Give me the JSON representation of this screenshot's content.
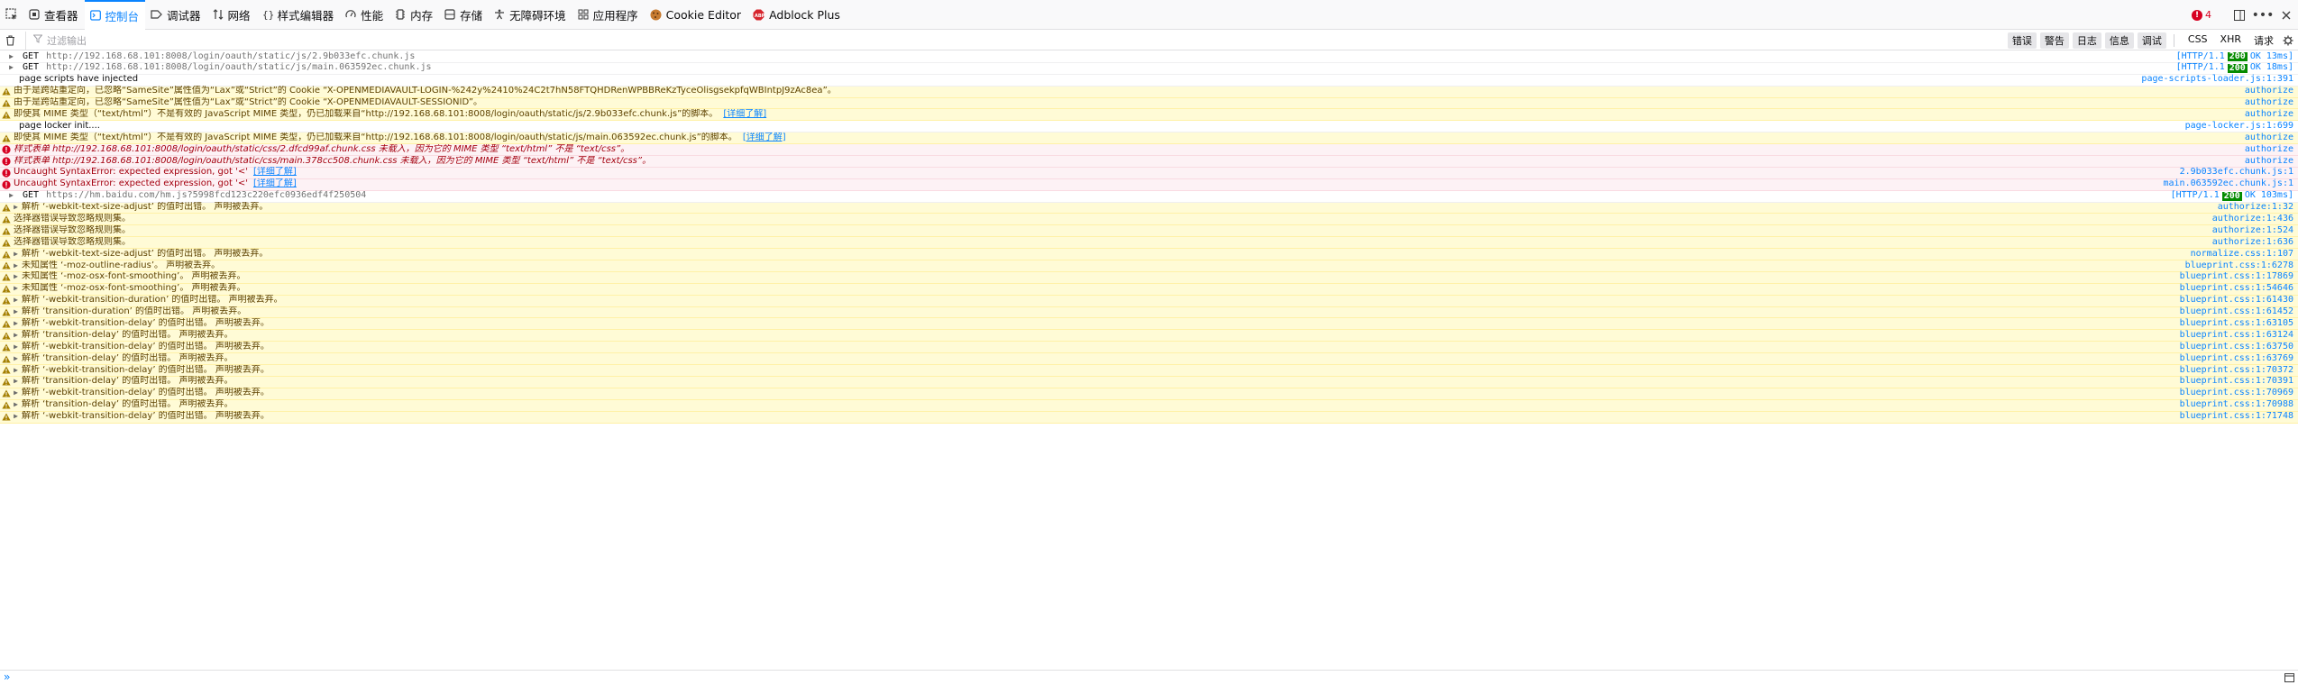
{
  "toolbar": {
    "tabs": [
      {
        "label": "查看器",
        "icon": "inspector-icon"
      },
      {
        "label": "控制台",
        "icon": "console-icon",
        "selected": true
      },
      {
        "label": "调试器",
        "icon": "debugger-icon"
      },
      {
        "label": "网络",
        "icon": "network-icon"
      },
      {
        "label": "样式编辑器",
        "icon": "style-editor-icon"
      },
      {
        "label": "性能",
        "icon": "performance-icon"
      },
      {
        "label": "内存",
        "icon": "memory-icon"
      },
      {
        "label": "存储",
        "icon": "storage-icon"
      },
      {
        "label": "无障碍环境",
        "icon": "accessibility-icon"
      },
      {
        "label": "应用程序",
        "icon": "application-icon"
      },
      {
        "label": "Cookie Editor",
        "icon": "cookie-icon"
      },
      {
        "label": "Adblock Plus",
        "icon": "adblock-icon"
      }
    ],
    "error_count": "4",
    "accent": "#0a84ff"
  },
  "filter": {
    "placeholder": "过滤输出",
    "levels": [
      "错误",
      "警告",
      "日志",
      "信息",
      "调试"
    ],
    "types": [
      "CSS",
      "XHR",
      "请求"
    ]
  },
  "messages": [
    {
      "type": "net",
      "method": "GET",
      "url": "http://192.168.68.101:8008/login/oauth/static/js/2.9b033efc.chunk.js",
      "proto": "[HTTP/1.1",
      "code": "200",
      "text": "OK 13ms]"
    },
    {
      "type": "net",
      "method": "GET",
      "url": "http://192.168.68.101:8008/login/oauth/static/js/main.063592ec.chunk.js",
      "proto": "[HTTP/1.1",
      "code": "200",
      "text": "OK 18ms]"
    },
    {
      "type": "log",
      "text": "page scripts have injected",
      "src": "page-scripts-loader.js:1:391"
    },
    {
      "type": "warn",
      "text": "由于是跨站重定向，已忽略“SameSite”属性值为“Lax”或“Strict”的 Cookie “X-OPENMEDIAVAULT-LOGIN-%242y%2410%24C2t7hN58FTQHDRenWPBBReKzTyceOlisgsekpfqWBIntpJ9zAc8ea”。",
      "src": "authorize"
    },
    {
      "type": "warn",
      "text": "由于是跨站重定向，已忽略“SameSite”属性值为“Lax”或“Strict”的 Cookie “X-OPENMEDIAVAULT-SESSIONID”。",
      "src": "authorize"
    },
    {
      "type": "warn",
      "text": "即使其 MIME 类型（“text/html”）不是有效的 JavaScript MIME 类型，仍已加载来自“http://192.168.68.101:8008/login/oauth/static/js/2.9b033efc.chunk.js”的脚本。",
      "link": "[详细了解]",
      "src": "authorize"
    },
    {
      "type": "log",
      "text": "page locker init....",
      "src": "page-locker.js:1:699"
    },
    {
      "type": "warn",
      "text": "即使其 MIME 类型（“text/html”）不是有效的 JavaScript MIME 类型，仍已加载来自“http://192.168.68.101:8008/login/oauth/static/js/main.063592ec.chunk.js”的脚本。",
      "link": "[详细了解]",
      "src": "authorize"
    },
    {
      "type": "error",
      "text": "样式表单 http://192.168.68.101:8008/login/oauth/static/css/2.dfcd99af.chunk.css 未载入，因为它的 MIME 类型 “text/html” 不是 “text/css”。",
      "src": "authorize"
    },
    {
      "type": "error",
      "text": "样式表单 http://192.168.68.101:8008/login/oauth/static/css/main.378cc508.chunk.css 未载入，因为它的 MIME 类型 “text/html” 不是 “text/css”。",
      "src": "authorize"
    },
    {
      "type": "error",
      "text": "Uncaught SyntaxError: expected expression, got '<'",
      "link": "[详细了解]",
      "src": "2.9b033efc.chunk.js:1"
    },
    {
      "type": "error",
      "text": "Uncaught SyntaxError: expected expression, got '<'",
      "link": "[详细了解]",
      "src": "main.063592ec.chunk.js:1"
    },
    {
      "type": "net",
      "method": "GET",
      "url": "https://hm.baidu.com/hm.js?5998fcd123c220efc0936edf4f250504",
      "proto": "[HTTP/1.1",
      "code": "200",
      "text": "OK 103ms]"
    },
    {
      "type": "warn",
      "tw": true,
      "text": "解析 ‘-webkit-text-size-adjust’ 的值时出错。  声明被丢弃。",
      "src": "authorize:1:32"
    },
    {
      "type": "warn",
      "text": "选择器错误导致忽略规则集。",
      "src": "authorize:1:436"
    },
    {
      "type": "warn",
      "text": "选择器错误导致忽略规则集。",
      "src": "authorize:1:524"
    },
    {
      "type": "warn",
      "text": "选择器错误导致忽略规则集。",
      "src": "authorize:1:636"
    },
    {
      "type": "warn",
      "tw": true,
      "text": "解析 ‘-webkit-text-size-adjust’ 的值时出错。  声明被丢弃。",
      "src": "normalize.css:1:107"
    },
    {
      "type": "warn",
      "tw": true,
      "text": "未知属性 ‘-moz-outline-radius’。  声明被丢弃。",
      "src": "blueprint.css:1:6278"
    },
    {
      "type": "warn",
      "tw": true,
      "text": "未知属性 ‘-moz-osx-font-smoothing’。  声明被丢弃。",
      "src": "blueprint.css:1:17869"
    },
    {
      "type": "warn",
      "tw": true,
      "text": "未知属性 ‘-moz-osx-font-smoothing’。  声明被丢弃。",
      "src": "blueprint.css:1:54646"
    },
    {
      "type": "warn",
      "tw": true,
      "text": "解析 ‘-webkit-transition-duration’ 的值时出错。  声明被丢弃。",
      "src": "blueprint.css:1:61430"
    },
    {
      "type": "warn",
      "tw": true,
      "text": "解析 ‘transition-duration’ 的值时出错。  声明被丢弃。",
      "src": "blueprint.css:1:61452"
    },
    {
      "type": "warn",
      "tw": true,
      "text": "解析 ‘-webkit-transition-delay’ 的值时出错。  声明被丢弃。",
      "src": "blueprint.css:1:63105"
    },
    {
      "type": "warn",
      "tw": true,
      "text": "解析 ‘transition-delay’ 的值时出错。  声明被丢弃。",
      "src": "blueprint.css:1:63124"
    },
    {
      "type": "warn",
      "tw": true,
      "text": "解析 ‘-webkit-transition-delay’ 的值时出错。  声明被丢弃。",
      "src": "blueprint.css:1:63750"
    },
    {
      "type": "warn",
      "tw": true,
      "text": "解析 ‘transition-delay’ 的值时出错。  声明被丢弃。",
      "src": "blueprint.css:1:63769"
    },
    {
      "type": "warn",
      "tw": true,
      "text": "解析 ‘-webkit-transition-delay’ 的值时出错。  声明被丢弃。",
      "src": "blueprint.css:1:70372"
    },
    {
      "type": "warn",
      "tw": true,
      "text": "解析 ‘transition-delay’ 的值时出错。  声明被丢弃。",
      "src": "blueprint.css:1:70391"
    },
    {
      "type": "warn",
      "tw": true,
      "text": "解析 ‘-webkit-transition-delay’ 的值时出错。  声明被丢弃。",
      "src": "blueprint.css:1:70969"
    },
    {
      "type": "warn",
      "tw": true,
      "text": "解析 ‘transition-delay’ 的值时出错。  声明被丢弃。",
      "src": "blueprint.css:1:70988"
    },
    {
      "type": "warn",
      "tw": true,
      "text": "解析 ‘-webkit-transition-delay’ 的值时出错。  声明被丢弃。",
      "src": "blueprint.css:1:71748"
    }
  ]
}
